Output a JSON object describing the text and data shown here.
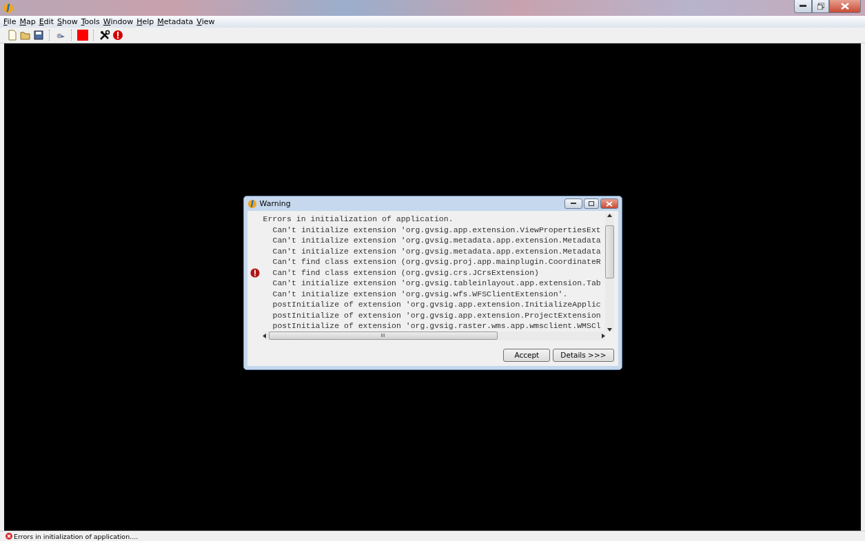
{
  "menu": [
    {
      "label": "File"
    },
    {
      "label": "Map"
    },
    {
      "label": "Edit"
    },
    {
      "label": "Show"
    },
    {
      "label": "Tools"
    },
    {
      "label": "Window"
    },
    {
      "label": "Help"
    },
    {
      "label": "Metadata"
    },
    {
      "label": "View"
    }
  ],
  "toolbar": [
    {
      "kind": "new"
    },
    {
      "kind": "open"
    },
    {
      "kind": "save"
    },
    {
      "kind": "sep"
    },
    {
      "kind": "config"
    },
    {
      "kind": "sep"
    },
    {
      "kind": "stop"
    },
    {
      "kind": "sep"
    },
    {
      "kind": "tools"
    },
    {
      "kind": "error"
    }
  ],
  "dialog": {
    "title": "Warning",
    "heading": "Errors in initialization of application.",
    "lines": [
      "Can't initialize extension 'org.gvsig.app.extension.ViewPropertiesExt",
      "Can't initialize extension 'org.gvsig.metadata.app.extension.Metadata",
      "Can't initialize extension 'org.gvsig.metadata.app.extension.Metadata",
      "Can't find class extension (org.gvsig.proj.app.mainplugin.CoordinateR",
      "Can't find class extension (org.gvsig.crs.JCrsExtension)",
      "Can't initialize extension 'org.gvsig.tableinlayout.app.extension.Tab",
      "Can't initialize extension 'org.gvsig.wfs.WFSClientExtension'.",
      "postInitialize of extension 'org.gvsig.app.extension.InitializeApplic",
      "postInitialize of extension 'org.gvsig.app.extension.ProjectExtension",
      "postInitialize of extension 'org.gvsig.raster.wms.app.wmsclient.WMSCl"
    ],
    "scroll_mark": "III",
    "buttons": [
      "Accept",
      "Details >>>"
    ]
  },
  "status_bar": {
    "text": "Errors in initialization of application...."
  }
}
